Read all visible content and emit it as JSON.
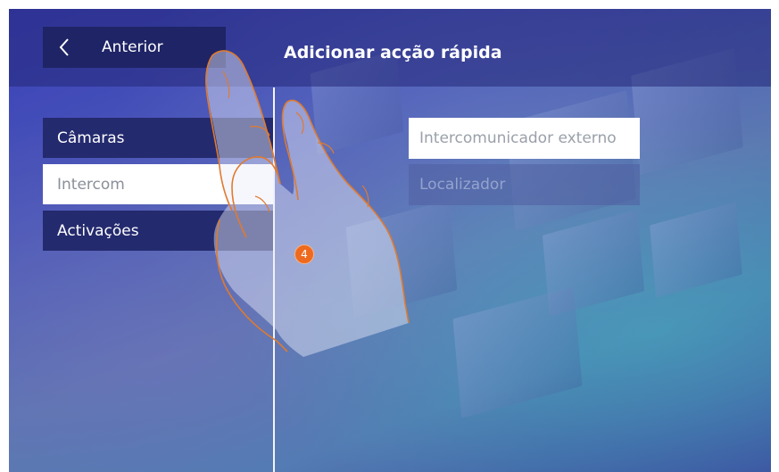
{
  "header": {
    "back_label": "Anterior",
    "title": "Adicionar acção rápida"
  },
  "menu": {
    "items": [
      {
        "label": "Câmaras",
        "state": "normal"
      },
      {
        "label": "Intercom",
        "state": "selected"
      },
      {
        "label": "Activações",
        "state": "normal"
      }
    ]
  },
  "options": {
    "items": [
      {
        "label": "Intercomunicador externo",
        "state": "enabled"
      },
      {
        "label": "Localizador",
        "state": "disabled"
      }
    ]
  },
  "step": {
    "number": "4"
  },
  "colors": {
    "accent_orange": "#ee6a1f",
    "button_dark": "#1f2466",
    "hand_outline": "#e07a2e"
  },
  "icons": {
    "back": "chevron-left-icon",
    "pointer": "hand-pointer-icon"
  }
}
